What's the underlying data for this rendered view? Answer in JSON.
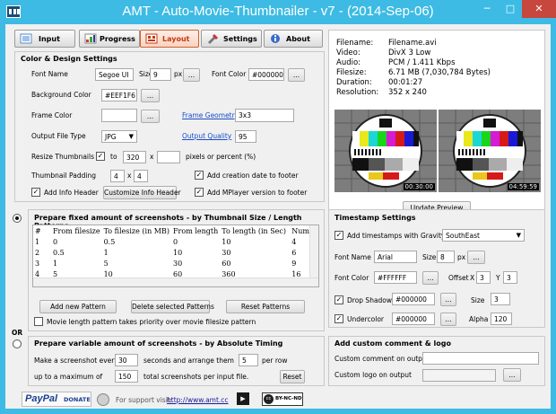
{
  "window": {
    "title": "AMT - Auto-Movie-Thumbnailer - v7 - (2014-Sep-06)",
    "minimize": "─",
    "maximize": "□",
    "close": "✕"
  },
  "tabs": [
    {
      "label": "Input",
      "icon": "input-icon"
    },
    {
      "label": "Progress",
      "icon": "progress-icon"
    },
    {
      "label": "Layout",
      "icon": "layout-icon",
      "active": true
    },
    {
      "label": "Settings",
      "icon": "settings-icon"
    },
    {
      "label": "About",
      "icon": "about-icon"
    }
  ],
  "design": {
    "header": "Color & Design Settings",
    "font_name_label": "Font Name",
    "font_name": "Segoe UI",
    "size_label": "Size",
    "size": "9",
    "px": "px",
    "browse": "...",
    "font_color_label": "Font Color",
    "font_color": "#000000",
    "bg_color_label": "Background Color",
    "bg_color": "#EEF1F6",
    "frame_color_label": "Frame Color",
    "frame_color": "",
    "frame_geometry_label": "Frame Geometry",
    "frame_geometry": "3x3",
    "output_type_label": "Output File Type",
    "output_type": "JPG",
    "output_quality_label": "Output Quality",
    "output_quality": "95",
    "resize_label": "Resize Thumbnails",
    "resize_checked": true,
    "to": "to",
    "resize_w": "320",
    "x": "x",
    "resize_h": "",
    "resize_unit": "pixels or percent (%)",
    "padding_label": "Thumbnail Padding",
    "padding_x": "4",
    "padding_y": "4",
    "add_creation_date": "Add creation date to footer",
    "add_info_header": "Add Info Header",
    "customize_info_header": "Customize Info Header",
    "add_mplayer_version": "Add MPlayer version to footer"
  },
  "info": {
    "filename_label": "Filename:",
    "filename": "Filename.avi",
    "video_label": "Video:",
    "video": "DivX 3 Low",
    "audio_label": "Audio:",
    "audio": "PCM / 1.411 Kbps",
    "filesize_label": "Filesize:",
    "filesize": "6.71 MB (7,030,784 Bytes)",
    "duration_label": "Duration:",
    "duration": "00:01:27",
    "resolution_label": "Resolution:",
    "resolution": "352 x 240",
    "thumb1_time": "00:30:00",
    "thumb2_time": "04:59:59",
    "update_preview": "Update Preview"
  },
  "patterns": {
    "header": "Prepare fixed amount of screenshots - by Thumbnail Size / Length Patterns",
    "columns": [
      "#",
      "From filesize",
      "To filesize (in MB)",
      "From length",
      "To length (in Sec)",
      "Num"
    ],
    "rows": [
      [
        "1",
        "0",
        "0.5",
        "0",
        "10",
        "4"
      ],
      [
        "2",
        "0.5",
        "1",
        "10",
        "30",
        "6"
      ],
      [
        "3",
        "1",
        "5",
        "30",
        "60",
        "9"
      ],
      [
        "4",
        "5",
        "10",
        "60",
        "360",
        "16"
      ]
    ],
    "add_pattern": "Add new Pattern",
    "delete_selected": "Delete selected Patterns",
    "reset_patterns": "Reset Patterns",
    "priority": "Movie length pattern takes priority over movie filesize pattern"
  },
  "or_label": "OR",
  "variable": {
    "header": "Prepare variable amount of screenshots - by Absolute Timing",
    "every_prefix": "Make a screenshot every",
    "every_value": "30",
    "every_suffix": "seconds and arrange them",
    "per_row_value": "5",
    "per_row_suffix": "per row",
    "max_prefix": "up to a maximum of",
    "max_value": "150",
    "max_suffix": "total screenshots per input file.",
    "reset": "Reset"
  },
  "timestamp": {
    "header": "Timestamp Settings",
    "add_label": "Add timestamps with Gravity",
    "gravity": "SouthEast",
    "font_name_label": "Font Name",
    "font_name": "Arial",
    "size_label": "Size",
    "size": "8",
    "px": "px",
    "browse": "...",
    "font_color_label": "Font Color",
    "font_color": "#FFFFFF",
    "offset_label": "Offset",
    "offset_x_label": "X",
    "offset_x": "3",
    "offset_y_label": "Y",
    "offset_y": "3",
    "drop_shadow": "Drop Shadow",
    "drop_shadow_color": "#000000",
    "size2_label": "Size",
    "size2": "3",
    "undercolor": "Undercolor",
    "undercolor_value": "#000000",
    "alpha_label": "Alpha",
    "alpha": "120"
  },
  "comment": {
    "header": "Add custom comment & logo",
    "comment_label": "Custom comment on output",
    "logo_label": "Custom logo on output",
    "browse": "..."
  },
  "footer": {
    "paypal": "PayPal",
    "donate": "DONATE",
    "support_text": "For support visit:",
    "support_url": "http://www.amt.cc",
    "license": "BY-NC-ND"
  }
}
